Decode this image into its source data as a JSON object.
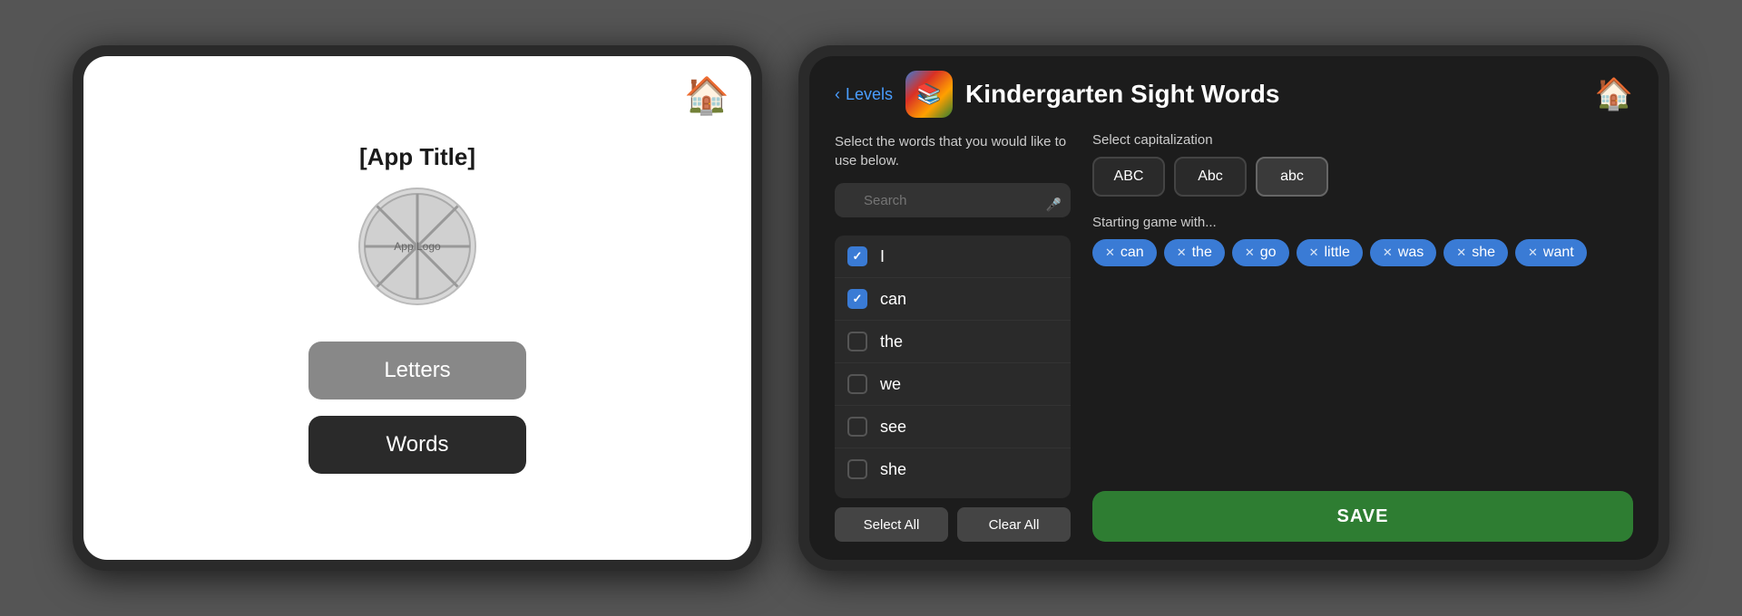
{
  "left_tablet": {
    "app_title": "[App Title]",
    "logo_text": "App Logo",
    "home_icon": "🏠",
    "letters_btn": "Letters",
    "words_btn": "Words"
  },
  "right_tablet": {
    "back_label": "Levels",
    "page_title": "Kindergarten Sight Words",
    "home_icon": "🏠",
    "word_panel": {
      "description": "Select the words that you would like to use below.",
      "search_placeholder": "Search",
      "words": [
        {
          "text": "I",
          "checked": true
        },
        {
          "text": "can",
          "checked": true
        },
        {
          "text": "the",
          "checked": false
        },
        {
          "text": "we",
          "checked": false
        },
        {
          "text": "see",
          "checked": false
        },
        {
          "text": "she",
          "checked": false
        }
      ],
      "select_all_label": "Select All",
      "clear_all_label": "Clear All"
    },
    "settings": {
      "cap_label": "Select capitalization",
      "cap_options": [
        "ABC",
        "Abc",
        "abc"
      ],
      "cap_active": "abc",
      "starting_label": "Starting game with...",
      "tags": [
        "can",
        "the",
        "go",
        "little",
        "was",
        "she",
        "want"
      ],
      "save_label": "SAVE"
    }
  }
}
